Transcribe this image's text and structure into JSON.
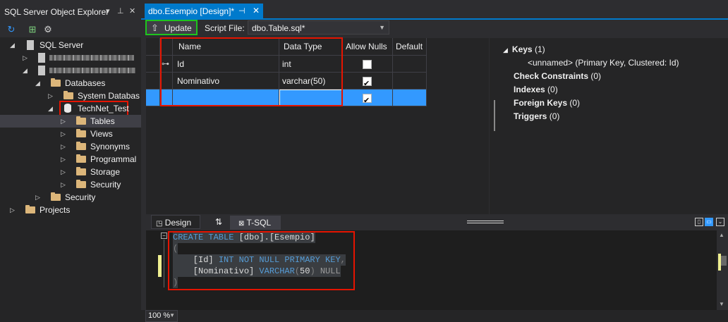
{
  "object_explorer": {
    "title": "SQL Server Object Explorer",
    "tree": {
      "sql_server": "SQL Server",
      "databases": "Databases",
      "system_databases": "System Databas",
      "technet_test": "TechNet_Test",
      "tables": "Tables",
      "views": "Views",
      "synonyms": "Synonyms",
      "programmability": "Programmal",
      "storage": "Storage",
      "security_db": "Security",
      "security_server": "Security",
      "projects": "Projects"
    }
  },
  "document_tab": {
    "title": "dbo.Esempio [Design]*"
  },
  "toolbar": {
    "update_label": "Update",
    "script_file_label": "Script File:",
    "script_file_value": "dbo.Table.sql*"
  },
  "grid": {
    "headers": [
      "Name",
      "Data Type",
      "Allow Nulls",
      "Default"
    ],
    "rows": [
      {
        "name": "Id",
        "type": "int",
        "allow_nulls": false,
        "default": "",
        "primary_key": true
      },
      {
        "name": "Nominativo",
        "type": "varchar(50)",
        "allow_nulls": true,
        "default": ""
      },
      {
        "name": "",
        "type": "",
        "allow_nulls": true,
        "default": ""
      }
    ]
  },
  "properties": {
    "keys_label": "Keys",
    "keys_count": "(1)",
    "key_item": "<unnamed>    (Primary Key, Clustered: Id)",
    "check_constraints": "Check Constraints",
    "check_constraints_count": "(0)",
    "indexes": "Indexes",
    "indexes_count": "(0)",
    "foreign_keys": "Foreign Keys",
    "foreign_keys_count": "(0)",
    "triggers": "Triggers",
    "triggers_count": "(0)"
  },
  "bottom_tabs": {
    "design": "Design",
    "swap": "⇅",
    "tsql": "T-SQL"
  },
  "sql": {
    "l1_kw": "CREATE TABLE",
    "l1_rest": " [dbo].[Esempio]",
    "l2": "(",
    "l3_id": "    [Id] ",
    "l3_kw": "INT NOT NULL PRIMARY KEY",
    "l3_end": ",",
    "l4_id": "    [Nominativo] ",
    "l4_kw": "VARCHAR",
    "l4_mid": "(",
    "l4_num": "50",
    "l4_close": ") ",
    "l4_null": "NULL",
    "l5": ")"
  },
  "zoom": "100 %",
  "colors": {
    "accent": "#007acc",
    "highlight_red": "#e51400",
    "highlight_green": "#1ec41e",
    "selection": "#3399ff"
  }
}
